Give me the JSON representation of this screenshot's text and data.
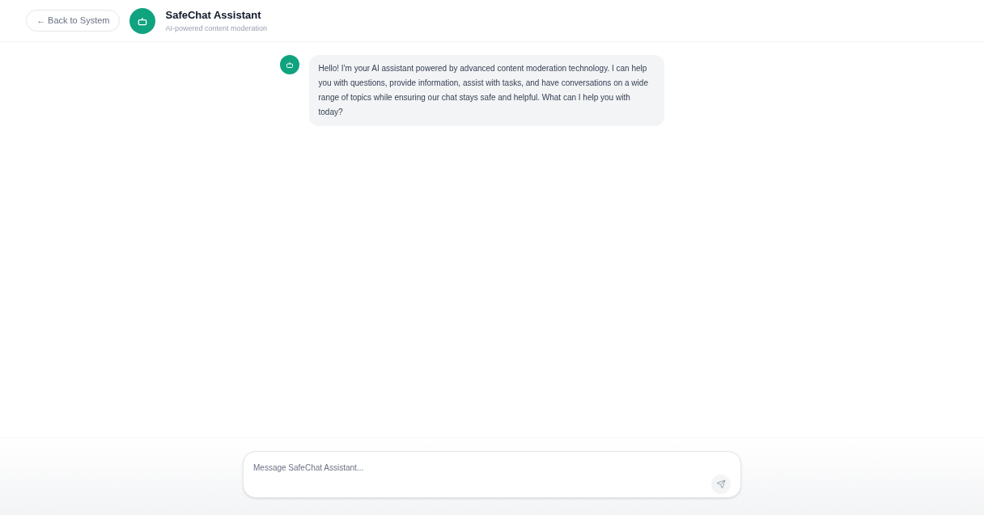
{
  "header": {
    "back_button": "← Back to System",
    "title": "SafeChat Assistant",
    "subtitle": "AI-powered content moderation"
  },
  "messages": [
    {
      "kind": "assistant",
      "text": "Hello! I'm your AI assistant powered by advanced content moderation technology. I can help you with questions, provide information, assist with tasks, and have conversations on a wide range of topics while ensuring our chat stays safe and helpful. What can I help you with today?"
    }
  ],
  "composer": {
    "placeholder": "Message SafeChat Assistant..."
  }
}
